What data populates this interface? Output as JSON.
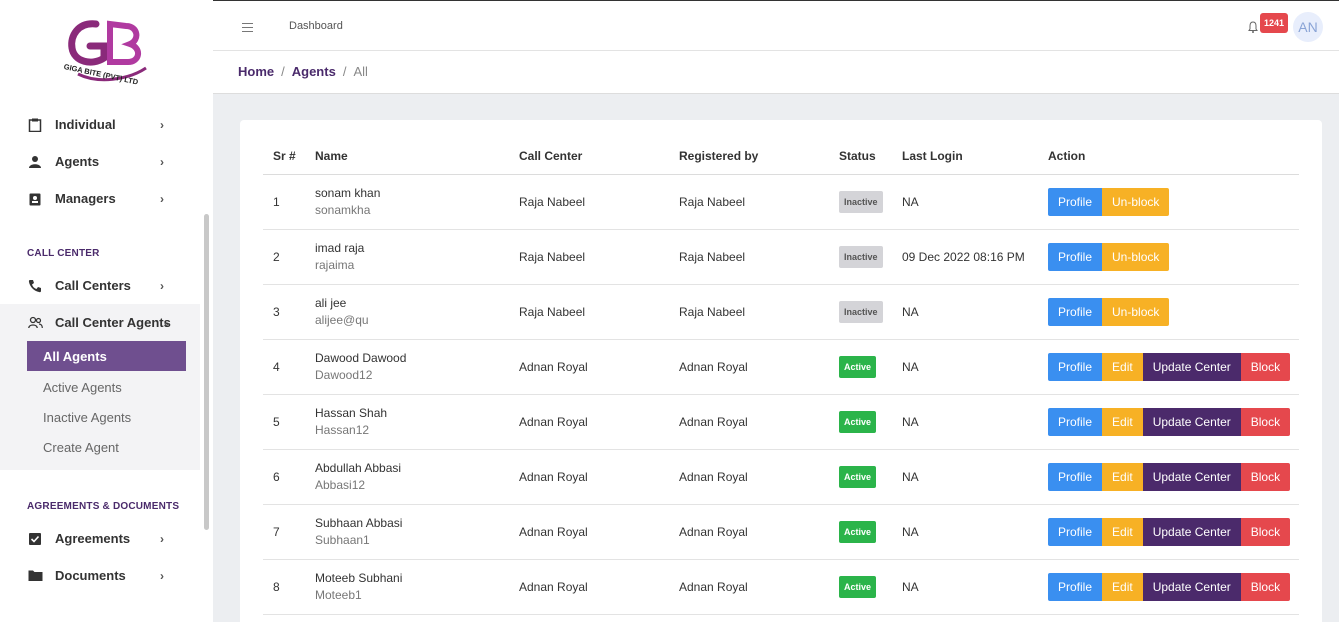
{
  "brand": {
    "logo_text": "GIGA BITE (PVT) LTD"
  },
  "sidebar": {
    "items_top": [
      {
        "label": "Individual",
        "icon": "clipboard-icon"
      },
      {
        "label": "Agents",
        "icon": "person-icon"
      },
      {
        "label": "Managers",
        "icon": "id-badge-icon"
      }
    ],
    "section_call_center": "CALL CENTER",
    "call_center": {
      "label": "Call Centers",
      "icon": "phone-icon"
    },
    "call_center_agents": {
      "label": "Call Center Agents",
      "icon": "people-icon"
    },
    "submenu": [
      {
        "label": "All Agents",
        "active": true
      },
      {
        "label": "Active Agents",
        "active": false
      },
      {
        "label": "Inactive Agents",
        "active": false
      },
      {
        "label": "Create Agent",
        "active": false
      }
    ],
    "section_agreements": "AGREEMENTS & DOCUMENTS",
    "agreements": {
      "label": "Agreements",
      "icon": "checkbox-icon"
    },
    "documents": {
      "label": "Documents",
      "icon": "folder-icon"
    }
  },
  "topbar": {
    "title": "Dashboard",
    "badge_count": "1241",
    "avatar_initials": "AN"
  },
  "breadcrumb": {
    "home": "Home",
    "agents": "Agents",
    "current": "All"
  },
  "table": {
    "headers": [
      "Sr #",
      "Name",
      "Call Center",
      "Registered by",
      "Status",
      "Last Login",
      "Action"
    ],
    "rows": [
      {
        "sr": "1",
        "name": "sonam khan",
        "username": "sonamkha",
        "call_center": "Raja Nabeel",
        "registered_by": "Raja Nabeel",
        "status": "Inactive",
        "last_login": "NA"
      },
      {
        "sr": "2",
        "name": "imad raja",
        "username": "rajaima",
        "call_center": "Raja Nabeel",
        "registered_by": "Raja Nabeel",
        "status": "Inactive",
        "last_login": "09 Dec 2022 08:16 PM"
      },
      {
        "sr": "3",
        "name": "ali jee",
        "username": "alijee@qu",
        "call_center": "Raja Nabeel",
        "registered_by": "Raja Nabeel",
        "status": "Inactive",
        "last_login": "NA"
      },
      {
        "sr": "4",
        "name": "Dawood Dawood",
        "username": "Dawood12",
        "call_center": "Adnan Royal",
        "registered_by": "Adnan Royal",
        "status": "Active",
        "last_login": "NA"
      },
      {
        "sr": "5",
        "name": "Hassan Shah",
        "username": "Hassan12",
        "call_center": "Adnan Royal",
        "registered_by": "Adnan Royal",
        "status": "Active",
        "last_login": "NA"
      },
      {
        "sr": "6",
        "name": "Abdullah Abbasi",
        "username": "Abbasi12",
        "call_center": "Adnan Royal",
        "registered_by": "Adnan Royal",
        "status": "Active",
        "last_login": "NA"
      },
      {
        "sr": "7",
        "name": "Subhaan Abbasi",
        "username": "Subhaan1",
        "call_center": "Adnan Royal",
        "registered_by": "Adnan Royal",
        "status": "Active",
        "last_login": "NA"
      },
      {
        "sr": "8",
        "name": "Moteeb Subhani",
        "username": "Moteeb1",
        "call_center": "Adnan Royal",
        "registered_by": "Adnan Royal",
        "status": "Active",
        "last_login": "NA"
      }
    ],
    "actions_inactive": [
      "Profile",
      "Un-block"
    ],
    "actions_active": [
      "Profile",
      "Edit",
      "Update Center",
      "Block"
    ]
  }
}
